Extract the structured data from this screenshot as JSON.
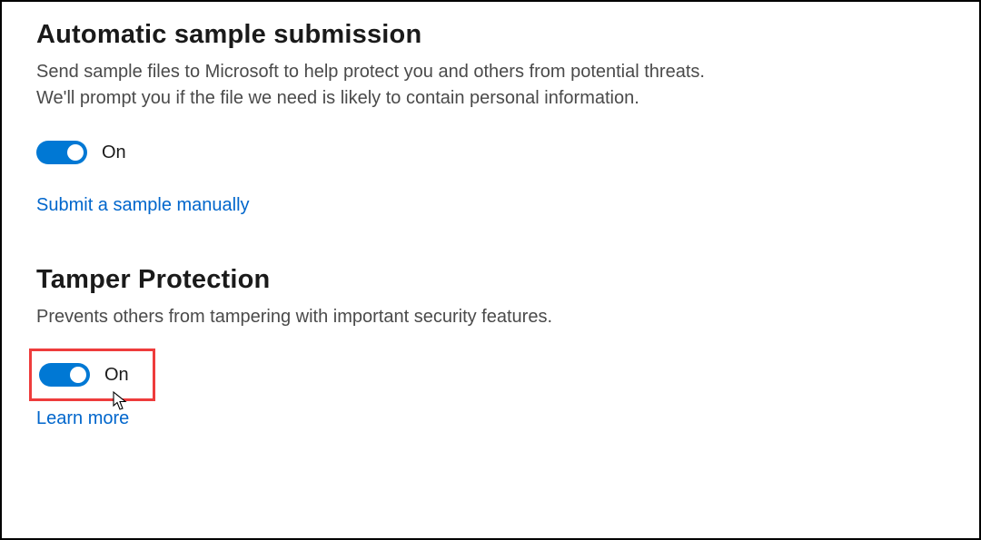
{
  "sections": {
    "automatic_sample": {
      "title": "Automatic sample submission",
      "description": "Send sample files to Microsoft to help protect you and others from potential threats. We'll prompt you if the file we need is likely to contain personal information.",
      "toggle_state": "On",
      "link_text": "Submit a sample manually"
    },
    "tamper_protection": {
      "title": "Tamper Protection",
      "description": "Prevents others from tampering with important security features.",
      "toggle_state": "On",
      "link_text": "Learn more"
    }
  },
  "colors": {
    "accent": "#0078d4",
    "link": "#0066cc",
    "highlight_border": "#ee3c3c"
  }
}
